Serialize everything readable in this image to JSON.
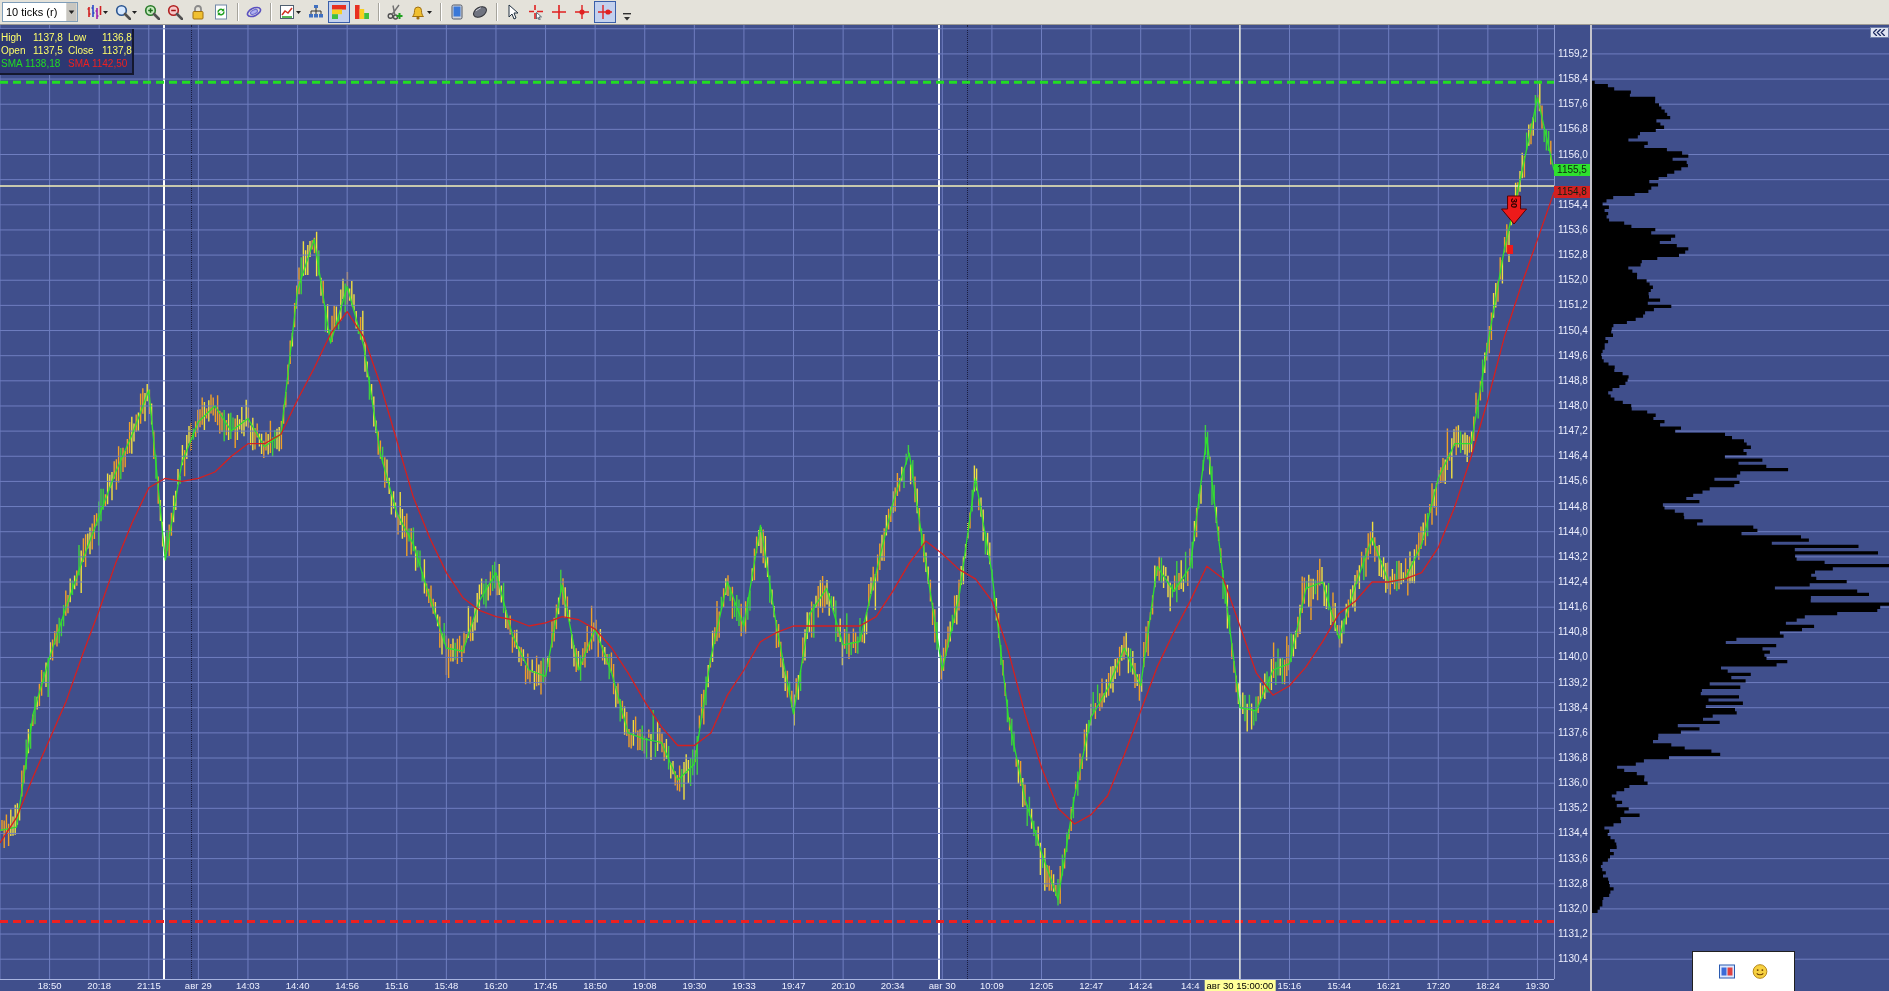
{
  "toolbar": {
    "interval": {
      "value": "10 ticks (r)"
    },
    "groups": [
      [
        {
          "selected": false,
          "menu": true
        },
        {
          "selected": false,
          "menu": true
        },
        {
          "selected": false,
          "menu": false
        },
        {
          "selected": false,
          "menu": false
        },
        {
          "selected": false,
          "menu": false
        },
        {
          "selected": false,
          "menu": false
        }
      ],
      [
        {
          "selected": false,
          "menu": false
        }
      ],
      [
        {
          "selected": false,
          "menu": true
        },
        {
          "selected": false,
          "menu": false
        },
        {
          "selected": true,
          "menu": false
        },
        {
          "selected": false,
          "menu": false
        }
      ],
      [
        {
          "selected": false,
          "menu": false
        },
        {
          "selected": false,
          "menu": true
        }
      ],
      [
        {
          "selected": false,
          "menu": false
        },
        {
          "selected": false,
          "menu": false
        }
      ],
      [
        {
          "selected": false,
          "menu": false
        },
        {
          "selected": false,
          "menu": false
        },
        {
          "selected": false,
          "menu": false
        },
        {
          "selected": false,
          "menu": false
        },
        {
          "selected": true,
          "menu": false
        }
      ]
    ]
  },
  "chart": {
    "info_box": {
      "fields": [
        {
          "label": "High",
          "value": "1137,8"
        },
        {
          "label": "Low",
          "value": "1136,8"
        },
        {
          "label": "Open",
          "value": "1137,5"
        },
        {
          "label": "Close",
          "value": "1137,8"
        }
      ],
      "indicators": [
        {
          "text": "SMA 1138,18",
          "color": "#22dd22"
        },
        {
          "text": "SMA 1142,50",
          "color": "#ee2020"
        }
      ]
    },
    "signal_marker": {
      "label": "30"
    },
    "chart_data": {
      "type": "line",
      "grid": true,
      "ylim": [
        1129.77,
        1160.12
      ],
      "categories": [
        null,
        null,
        null,
        "18:50",
        null,
        null,
        "20:18",
        null,
        null,
        "21:15",
        null,
        null,
        "авг 29",
        null,
        null,
        "14:03",
        null,
        null,
        "14:40",
        null,
        null,
        "14:56",
        null,
        null,
        "15:16",
        null,
        null,
        "15:48",
        null,
        null,
        "16:20",
        null,
        null,
        "17:45",
        null,
        null,
        "18:50",
        null,
        null,
        "19:08",
        null,
        null,
        "19:30",
        null,
        null,
        "19:33",
        null,
        null,
        "19:47",
        null,
        null,
        "20:10",
        null,
        null,
        "20:34",
        null,
        null,
        "авг 30",
        null,
        null,
        "10:09",
        null,
        null,
        "12:05",
        null,
        null,
        "12:47",
        null,
        null,
        "14:24",
        null,
        null,
        "14:4",
        null,
        null,
        "авг 30 15:00:00",
        null,
        null,
        "15:16",
        null,
        null,
        "15:44",
        null,
        null,
        "16:21",
        null,
        null,
        "17:20",
        null,
        null,
        "18:24",
        null,
        null,
        "19:30",
        null
      ],
      "yticks": [
        {
          "value": 1159.2,
          "label": "1159,2"
        },
        {
          "value": 1158.4,
          "label": "1158,4"
        },
        {
          "value": 1157.6,
          "label": "1157,6"
        },
        {
          "value": 1156.8,
          "label": "1156,8"
        },
        {
          "value": 1156.0,
          "label": "1156,0"
        },
        {
          "value": 1154.4,
          "label": "1154,4"
        },
        {
          "value": 1153.6,
          "label": "1153,6"
        },
        {
          "value": 1152.8,
          "label": "1152,8"
        },
        {
          "value": 1152.0,
          "label": "1152,0"
        },
        {
          "value": 1151.2,
          "label": "1151,2"
        },
        {
          "value": 1150.4,
          "label": "1150,4"
        },
        {
          "value": 1149.6,
          "label": "1149,6"
        },
        {
          "value": 1148.8,
          "label": "1148,8"
        },
        {
          "value": 1148.0,
          "label": "1148,0"
        },
        {
          "value": 1147.2,
          "label": "1147,2"
        },
        {
          "value": 1146.4,
          "label": "1146,4"
        },
        {
          "value": 1145.6,
          "label": "1145,6"
        },
        {
          "value": 1144.8,
          "label": "1144,8"
        },
        {
          "value": 1144.0,
          "label": "1144,0"
        },
        {
          "value": 1143.2,
          "label": "1143,2"
        },
        {
          "value": 1142.4,
          "label": "1142,4"
        },
        {
          "value": 1141.6,
          "label": "1141,6"
        },
        {
          "value": 1140.8,
          "label": "1140,8"
        },
        {
          "value": 1140.0,
          "label": "1140,0"
        },
        {
          "value": 1139.2,
          "label": "1139,2"
        },
        {
          "value": 1138.4,
          "label": "1138,4"
        },
        {
          "value": 1137.6,
          "label": "1137,6"
        },
        {
          "value": 1136.8,
          "label": "1136,8"
        },
        {
          "value": 1136.0,
          "label": "1136,0"
        },
        {
          "value": 1135.2,
          "label": "1135,2"
        },
        {
          "value": 1134.4,
          "label": "1134,4"
        },
        {
          "value": 1133.6,
          "label": "1133,6"
        },
        {
          "value": 1132.8,
          "label": "1132,8"
        },
        {
          "value": 1132.0,
          "label": "1132,0"
        },
        {
          "value": 1131.2,
          "label": "1131,2"
        },
        {
          "value": 1130.4,
          "label": "1130,4"
        }
      ],
      "series": [
        {
          "color": "#2ee02e",
          "values": [
            1134.5,
            1134.6,
            1138.2,
            1140.0,
            1141.6,
            1143.1,
            1144.5,
            1145.9,
            1147.1,
            1148.5,
            1143.1,
            1146.2,
            1147.5,
            1148.0,
            1147.2,
            1147.6,
            1146.7,
            1147.1,
            1151.7,
            1153.3,
            1150.0,
            1151.8,
            1149.9,
            1146.5,
            1144.6,
            1143.6,
            1141.9,
            1140.3,
            1140.2,
            1141.8,
            1142.7,
            1140.7,
            1139.6,
            1139.4,
            1142.3,
            1139.6,
            1140.9,
            1139.5,
            1137.6,
            1137.4,
            1137.3,
            1136.1,
            1136.6,
            1140.0,
            1142.4,
            1141.0,
            1144.2,
            1140.9,
            1138.2,
            1141.4,
            1142.2,
            1140.4,
            1140.5,
            1142.7,
            1144.9,
            1146.5,
            1143.0,
            1139.6,
            1141.9,
            1145.7,
            1142.7,
            1138.1,
            1135.5,
            1133.8,
            1132.3,
            1135.6,
            1138.1,
            1139.0,
            1140.3,
            1139.1,
            1142.9,
            1142.1,
            1142.9,
            1147.0,
            1142.5,
            1138.4,
            1138.3,
            1139.6,
            1139.8,
            1142.2,
            1142.4,
            1140.6,
            1142.3,
            1143.8,
            1142.4,
            1142.5,
            1143.6,
            1145.7,
            1146.8,
            1146.8,
            1150.0,
            1153.0,
            1155.3,
            1157.8,
            1155.5
          ]
        },
        {
          "color": "#d42020",
          "values": [
            1134.1,
            1134.9,
            1136.2,
            1137.4,
            1138.6,
            1140.1,
            1141.5,
            1143.0,
            1144.3,
            1145.4,
            1145.7,
            1145.6,
            1145.7,
            1145.9,
            1146.4,
            1146.8,
            1146.8,
            1147.1,
            1148.2,
            1149.2,
            1150.3,
            1151.0,
            1150.2,
            1148.7,
            1146.9,
            1145.1,
            1143.8,
            1142.7,
            1141.9,
            1141.5,
            1141.3,
            1141.2,
            1141.0,
            1141.1,
            1141.3,
            1141.2,
            1140.9,
            1140.3,
            1139.5,
            1138.6,
            1137.8,
            1137.2,
            1137.2,
            1137.6,
            1138.8,
            1139.6,
            1140.5,
            1140.8,
            1141.0,
            1141.0,
            1141.0,
            1141.0,
            1141.0,
            1141.3,
            1142.1,
            1143.0,
            1143.7,
            1143.3,
            1142.8,
            1142.5,
            1141.8,
            1140.2,
            1138.2,
            1136.5,
            1135.2,
            1134.7,
            1135.0,
            1135.6,
            1136.9,
            1138.3,
            1139.7,
            1140.8,
            1141.8,
            1142.9,
            1142.5,
            1141.0,
            1139.5,
            1138.8,
            1139.1,
            1139.7,
            1140.5,
            1141.4,
            1141.8,
            1142.4,
            1142.4,
            1142.5,
            1142.7,
            1143.5,
            1144.8,
            1146.4,
            1148.2,
            1150.2,
            1151.8,
            1153.3,
            1154.8
          ]
        }
      ],
      "ref_lines": [
        {
          "axis": "y",
          "value": 1158.3,
          "color": "#22dd22"
        },
        {
          "axis": "y",
          "value": 1131.6,
          "color": "#ee2020"
        },
        {
          "axis": "y",
          "value": 1155.0,
          "color": "#f4f0b8"
        },
        {
          "axis": "x",
          "value": "авг 30 15:00:00",
          "color": "#f4f4e0"
        }
      ],
      "annotations": [
        {
          "y": 1155.5,
          "text": "1155,5"
        },
        {
          "y": 1154.8,
          "text": "1154,8"
        }
      ]
    }
  }
}
